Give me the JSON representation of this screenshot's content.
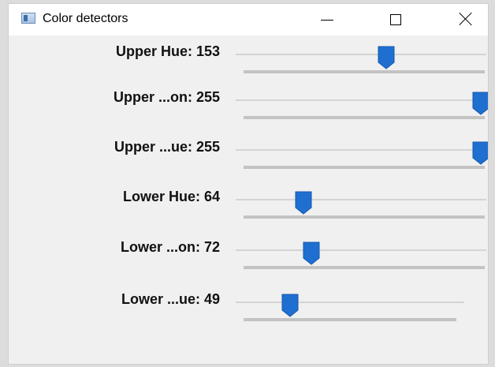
{
  "window": {
    "title": "Color detectors",
    "icon": "app-window-icon",
    "controls": [
      "minimize-icon",
      "maximize-icon",
      "close-icon"
    ]
  },
  "trackbar_max": 255,
  "accent_color": "#1f6fd1",
  "trackbars": [
    {
      "label": "Upper Hue: 153",
      "value": 153
    },
    {
      "label": "Upper ...on: 255",
      "value": 255
    },
    {
      "label": "Upper ...ue: 255",
      "value": 255
    },
    {
      "label": "Lower Hue: 64",
      "value": 64
    },
    {
      "label": "Lower ...on: 72",
      "value": 72
    },
    {
      "label": "Lower ...ue: 49",
      "value": 49
    }
  ]
}
